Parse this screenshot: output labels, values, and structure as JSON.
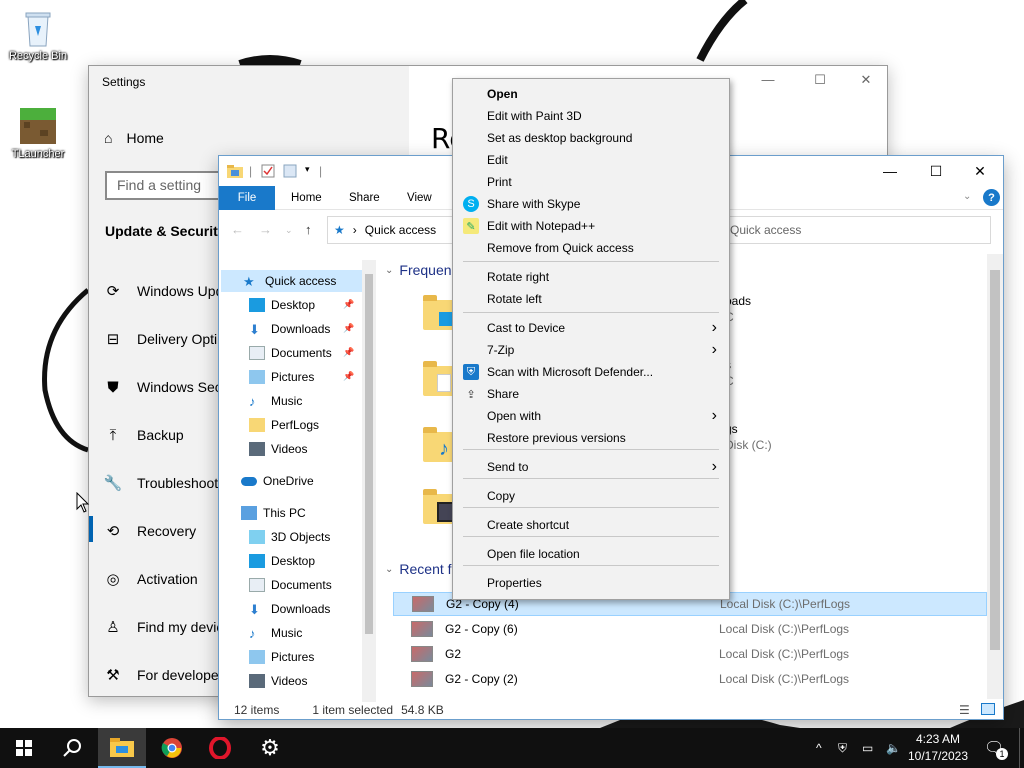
{
  "desktop": {
    "icons": [
      {
        "label": "Recycle Bin",
        "icon": "recycle-bin-icon"
      },
      {
        "label": "TLauncher",
        "icon": "tlauncher-icon"
      }
    ]
  },
  "settings": {
    "title": "Settings",
    "home": "Home",
    "search_placeholder": "Find a setting",
    "group": "Update & Security",
    "items": [
      {
        "label": "Windows Upd",
        "icon": "sync-icon"
      },
      {
        "label": "Delivery Optim",
        "icon": "delivery-icon"
      },
      {
        "label": "Windows Sec",
        "icon": "shield-icon"
      },
      {
        "label": "Backup",
        "icon": "backup-icon"
      },
      {
        "label": "Troubleshoot",
        "icon": "wrench-icon"
      },
      {
        "label": "Recovery",
        "icon": "recovery-icon"
      },
      {
        "label": "Activation",
        "icon": "activation-icon"
      },
      {
        "label": "Find my devic",
        "icon": "person-icon"
      },
      {
        "label": "For developer",
        "icon": "developer-icon"
      }
    ],
    "page_heading_partial": "Re",
    "accent": "#0063b1"
  },
  "explorer": {
    "ribbon_tabs": [
      "File",
      "Home",
      "Share",
      "View"
    ],
    "address": "Quick access",
    "search_placeholder": "Quick access",
    "nav": [
      {
        "label": "Quick access",
        "icon": "star-icon"
      },
      {
        "label": "Desktop",
        "icon": "desktop-icon"
      },
      {
        "label": "Downloads",
        "icon": "download-icon"
      },
      {
        "label": "Documents",
        "icon": "documents-icon"
      },
      {
        "label": "Pictures",
        "icon": "pictures-icon"
      },
      {
        "label": "Music",
        "icon": "music-icon"
      },
      {
        "label": "PerfLogs",
        "icon": "folder-icon"
      },
      {
        "label": "Videos",
        "icon": "videos-icon"
      },
      {
        "label": "OneDrive",
        "icon": "cloud-icon"
      },
      {
        "label": "This PC",
        "icon": "pc-icon"
      },
      {
        "label": "3D Objects",
        "icon": "cube-icon"
      },
      {
        "label": "Desktop",
        "icon": "desktop-icon"
      },
      {
        "label": "Documents",
        "icon": "documents-icon"
      },
      {
        "label": "Downloads",
        "icon": "download-icon"
      },
      {
        "label": "Music",
        "icon": "music-icon"
      },
      {
        "label": "Pictures",
        "icon": "pictures-icon"
      },
      {
        "label": "Videos",
        "icon": "videos-icon"
      }
    ],
    "frequent_heading": "Frequen",
    "frequent_right": [
      {
        "top": "oads",
        "bottom": "C"
      },
      {
        "top": "s",
        "bottom": "C"
      },
      {
        "top": "gs",
        "bottom": "Disk (C:)"
      }
    ],
    "recent_heading": "Recent f",
    "recent": [
      {
        "name": "G2 - Copy (4)",
        "location": "Local Disk (C:)\\PerfLogs"
      },
      {
        "name": "G2 - Copy (6)",
        "location": "Local Disk (C:)\\PerfLogs"
      },
      {
        "name": "G2",
        "location": "Local Disk (C:)\\PerfLogs"
      },
      {
        "name": "G2 - Copy (2)",
        "location": "Local Disk (C:)\\PerfLogs"
      }
    ],
    "status": {
      "items": "12 items",
      "selected": "1 item selected",
      "size": "54.8 KB"
    }
  },
  "context_menu": {
    "items": [
      {
        "label": "Open",
        "bold": true
      },
      {
        "label": "Edit with Paint 3D"
      },
      {
        "label": "Set as desktop background"
      },
      {
        "label": "Edit"
      },
      {
        "label": "Print"
      },
      {
        "label": "Share with Skype",
        "icon": "skype-icon"
      },
      {
        "label": "Edit with Notepad++",
        "icon": "notepadpp-icon"
      },
      {
        "label": "Remove from Quick access"
      },
      {
        "label": "Rotate right"
      },
      {
        "label": "Rotate left"
      },
      {
        "label": "Cast to Device",
        "submenu": true
      },
      {
        "label": "7-Zip",
        "submenu": true
      },
      {
        "label": "Scan with Microsoft Defender...",
        "icon": "defender-icon"
      },
      {
        "label": "Share",
        "icon": "share-icon"
      },
      {
        "label": "Open with",
        "submenu": true
      },
      {
        "label": "Restore previous versions"
      },
      {
        "label": "Send to",
        "submenu": true
      },
      {
        "label": "Copy"
      },
      {
        "label": "Create shortcut"
      },
      {
        "label": "Open file location"
      },
      {
        "label": "Properties"
      }
    ]
  },
  "taskbar": {
    "pinned": [
      "start-icon",
      "search-icon",
      "file-explorer-icon",
      "chrome-icon",
      "opera-icon",
      "settings-icon"
    ],
    "time": "4:23 AM",
    "date": "10/17/2023",
    "notification_count": "1"
  }
}
